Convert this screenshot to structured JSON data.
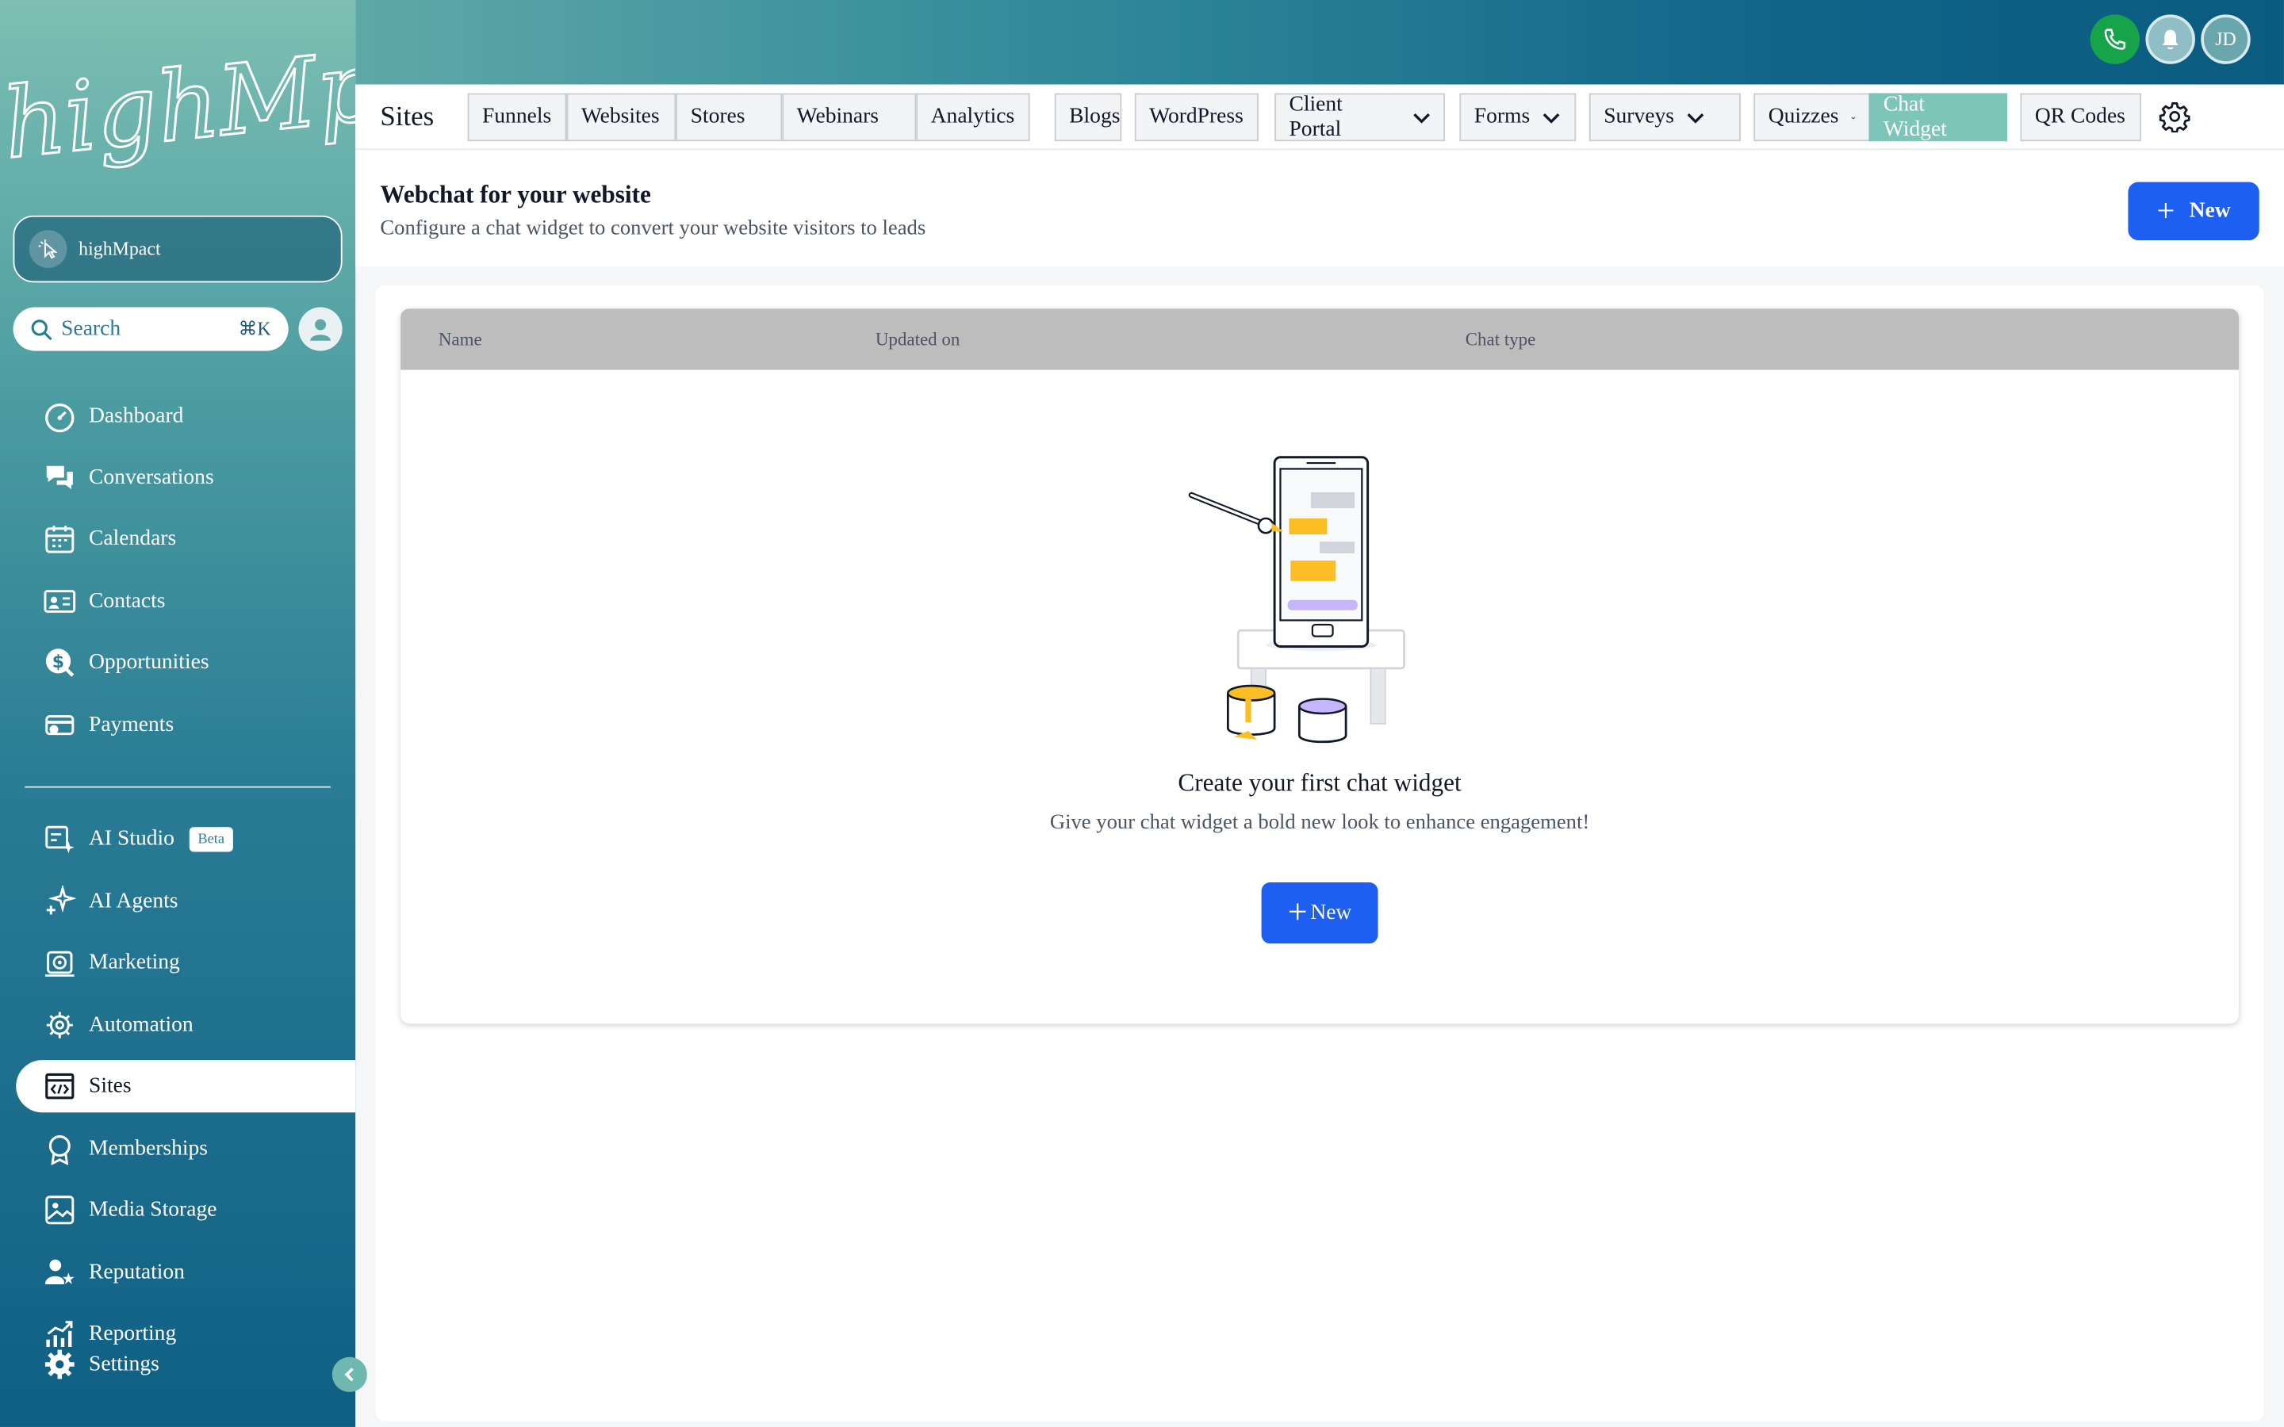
{
  "brand": {
    "logo_text": "highMpact",
    "account_name": "highMpact"
  },
  "search": {
    "label": "Search",
    "shortcut": "⌘K"
  },
  "sidebar": {
    "items": [
      {
        "label": "Dashboard",
        "icon": "dashboard-icon"
      },
      {
        "label": "Conversations",
        "icon": "chat-bubbles-icon"
      },
      {
        "label": "Calendars",
        "icon": "calendar-icon"
      },
      {
        "label": "Contacts",
        "icon": "contact-card-icon"
      },
      {
        "label": "Opportunities",
        "icon": "dollar-icon"
      },
      {
        "label": "Payments",
        "icon": "payments-icon"
      },
      {
        "label": "AI Studio",
        "icon": "ai-studio-icon",
        "badge": "Beta"
      },
      {
        "label": "AI Agents",
        "icon": "sparkle-icon"
      },
      {
        "label": "Marketing",
        "icon": "marketing-icon"
      },
      {
        "label": "Automation",
        "icon": "automation-gear-icon"
      },
      {
        "label": "Sites",
        "icon": "code-window-icon",
        "active": true
      },
      {
        "label": "Memberships",
        "icon": "award-icon"
      },
      {
        "label": "Media Storage",
        "icon": "image-icon"
      },
      {
        "label": "Reputation",
        "icon": "reputation-icon"
      },
      {
        "label": "Reporting",
        "icon": "chart-icon"
      },
      {
        "label": "Settings",
        "icon": "settings-gear-icon"
      }
    ]
  },
  "topbar": {
    "user_initials": "JD"
  },
  "tabs": {
    "section_title": "Sites",
    "items": [
      {
        "label": "Funnels"
      },
      {
        "label": "Websites"
      },
      {
        "label": "Stores"
      },
      {
        "label": "Webinars"
      },
      {
        "label": "Analytics"
      },
      {
        "label": "Blogs"
      },
      {
        "label": "WordPress"
      },
      {
        "label": "Client Portal",
        "dropdown": true
      },
      {
        "label": "Forms",
        "dropdown": true
      },
      {
        "label": "Surveys",
        "dropdown": true
      },
      {
        "label": "Quizzes",
        "dropdown": true
      },
      {
        "label": "Chat Widget",
        "selected": true
      },
      {
        "label": "QR Codes"
      }
    ]
  },
  "header": {
    "title": "Webchat for your website",
    "subtitle": "Configure a chat widget to convert your website visitors to leads",
    "new_label": "New"
  },
  "table": {
    "columns": [
      "Name",
      "Updated on",
      "Chat type"
    ]
  },
  "empty_state": {
    "title": "Create your first chat widget",
    "subtitle": "Give your chat widget a bold new look to enhance engagement!",
    "button_label": "New"
  },
  "colors": {
    "primary": "#1d5ff0",
    "selected_tab": "#7ec5b9",
    "phone": "#16a34a"
  }
}
